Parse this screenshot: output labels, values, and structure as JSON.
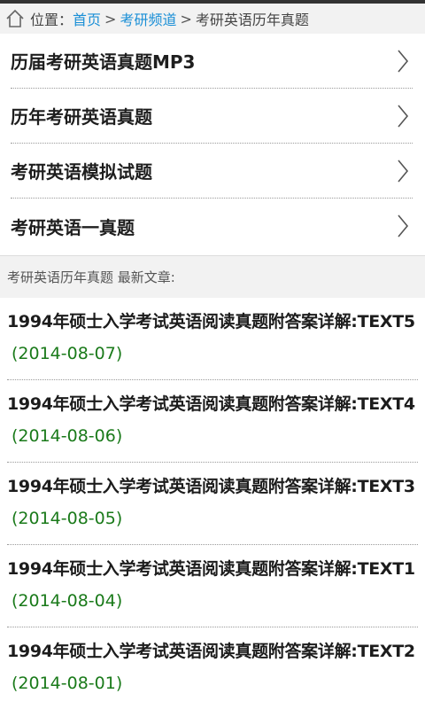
{
  "breadcrumb": {
    "prefix": "位置：",
    "home_link": "首页",
    "separator": ">",
    "channel_link": "考研频道",
    "current": "考研英语历年真题"
  },
  "menu": [
    {
      "label": "历届考研英语真题MP3"
    },
    {
      "label": "历年考研英语真题"
    },
    {
      "label": "考研英语模拟试题"
    },
    {
      "label": "考研英语一真题"
    }
  ],
  "section": {
    "title": "考研英语历年真题 最新文章:"
  },
  "articles": [
    {
      "title": "1994年硕士入学考试英语阅读真题附答案详解:TEXT5",
      "date": "(2014-08-07)"
    },
    {
      "title": "1994年硕士入学考试英语阅读真题附答案详解:TEXT4",
      "date": "(2014-08-06)"
    },
    {
      "title": "1994年硕士入学考试英语阅读真题附答案详解:TEXT3",
      "date": "(2014-08-05)"
    },
    {
      "title": "1994年硕士入学考试英语阅读真题附答案详解:TEXT1",
      "date": "(2014-08-04)"
    },
    {
      "title": "1994年硕士入学考试英语阅读真题附答案详解:TEXT2",
      "date": "(2014-08-01)"
    }
  ],
  "colors": {
    "link": "#1a8fd6",
    "date": "#1a7a1a",
    "header_bg": "#f2f2f2"
  },
  "icons": {
    "home": "home-icon",
    "chevron": "chevron-right-icon"
  }
}
